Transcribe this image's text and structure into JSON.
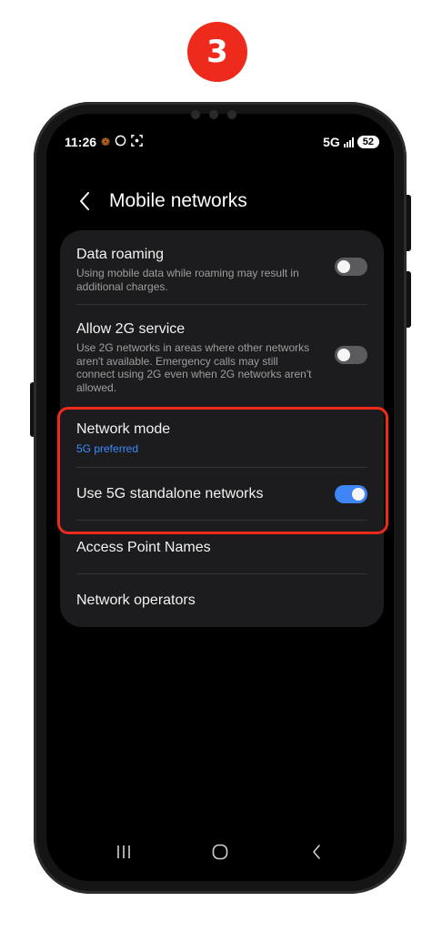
{
  "step_badge": "3",
  "status_bar": {
    "time": "11:26",
    "network": "5G",
    "battery": "52"
  },
  "header": {
    "title": "Mobile networks"
  },
  "settings": {
    "data_roaming": {
      "title": "Data roaming",
      "description": "Using mobile data while roaming may result in additional charges.",
      "enabled": false
    },
    "allow_2g": {
      "title": "Allow 2G service",
      "description": "Use 2G networks in areas where other networks aren't available. Emergency calls may still connect using 2G even when 2G networks aren't allowed.",
      "enabled": false
    },
    "network_mode": {
      "title": "Network mode",
      "value": "5G preferred"
    },
    "standalone_5g": {
      "title": "Use 5G standalone networks",
      "enabled": true
    },
    "access_point_names": {
      "title": "Access Point Names"
    },
    "network_operators": {
      "title": "Network operators"
    }
  },
  "colors": {
    "accent": "#3e86f5",
    "highlight": "#ee2a1c",
    "subtext_blue": "#3d8bff"
  },
  "icons": {
    "status_left": [
      "notification-icon",
      "whatsapp-icon",
      "screenshot-icon"
    ],
    "nav": [
      "recents-icon",
      "home-icon",
      "back-icon"
    ]
  }
}
